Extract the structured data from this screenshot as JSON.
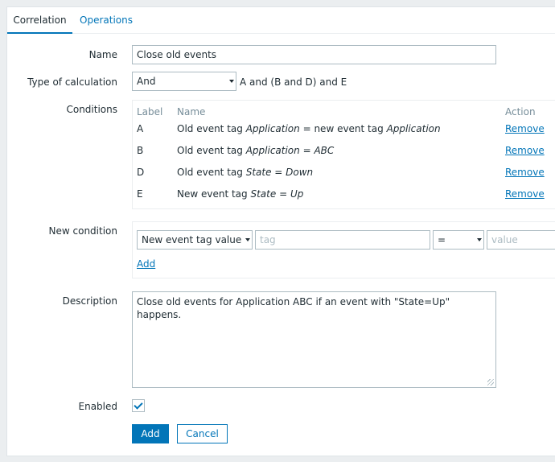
{
  "tabs": [
    {
      "label": "Correlation",
      "active": true
    },
    {
      "label": "Operations",
      "active": false
    }
  ],
  "form": {
    "name_label": "Name",
    "name_value": "Close old events",
    "calc_label": "Type of calculation",
    "calc_value": "And",
    "calc_formula": "A and (B and D) and E",
    "conditions_label": "Conditions",
    "conditions_header": {
      "label": "Label",
      "name": "Name",
      "action": "Action"
    },
    "conditions": [
      {
        "label": "A",
        "prefix": "Old event tag ",
        "tag": "Application",
        "op": " = new event tag ",
        "value": "Application",
        "action": "Remove"
      },
      {
        "label": "B",
        "prefix": "Old event tag ",
        "tag": "Application",
        "op": " = ",
        "value": "ABC",
        "action": "Remove"
      },
      {
        "label": "D",
        "prefix": "Old event tag ",
        "tag": "State",
        "op": " = ",
        "value": "Down",
        "action": "Remove"
      },
      {
        "label": "E",
        "prefix": "New event tag ",
        "tag": "State",
        "op": " = ",
        "value": "Up",
        "action": "Remove"
      }
    ],
    "new_condition_label": "New condition",
    "new_condition_type": "New event tag value",
    "new_condition_tag_placeholder": "tag",
    "new_condition_operator": "=",
    "new_condition_value_placeholder": "value",
    "new_condition_add": "Add",
    "description_label": "Description",
    "description_value": "Close old events for Application ABC if an event with \"State=Up\" happens.",
    "enabled_label": "Enabled",
    "enabled": true,
    "add_button": "Add",
    "cancel_button": "Cancel"
  },
  "colors": {
    "accent": "#0275b8",
    "border": "#acbbc2",
    "background": "#ebeef0"
  }
}
